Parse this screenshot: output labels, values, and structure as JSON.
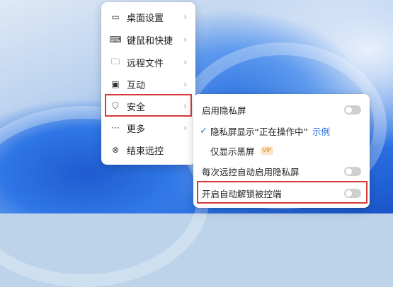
{
  "main_menu": {
    "items": [
      {
        "label": "桌面设置",
        "icon": "monitor-icon",
        "glyph": "▭",
        "has_submenu": true
      },
      {
        "label": "键鼠和快捷",
        "icon": "keyboard-icon",
        "glyph": "⌨",
        "has_submenu": true
      },
      {
        "label": "远程文件",
        "icon": "folder-icon",
        "glyph": "🗀",
        "has_submenu": true
      },
      {
        "label": "互动",
        "icon": "chat-icon",
        "glyph": "▣",
        "has_submenu": true
      },
      {
        "label": "安全",
        "icon": "shield-icon",
        "glyph": "⛉",
        "has_submenu": true
      },
      {
        "label": "更多",
        "icon": "more-icon",
        "glyph": "···",
        "has_submenu": true
      },
      {
        "label": "结束远控",
        "icon": "close-circle-icon",
        "glyph": "⊗",
        "has_submenu": false
      }
    ],
    "chevron": "›"
  },
  "security_submenu": {
    "enable_privacy_screen": {
      "label": "启用隐私屏",
      "enabled": false
    },
    "privacy_screen_shows": {
      "label": "隐私屏显示“正在操作中”",
      "link": "示例",
      "checked": true,
      "check_glyph": "✓"
    },
    "black_screen_only": {
      "label": "仅显示黑屏",
      "badge": "VIP"
    },
    "auto_enable_privacy": {
      "label": "每次远控自动启用隐私屏",
      "enabled": false
    },
    "auto_unlock": {
      "label": "开启自动解锁被控端",
      "enabled": false
    }
  },
  "colors": {
    "highlight_border": "#d43b3b",
    "accent": "#2b6fe4"
  }
}
